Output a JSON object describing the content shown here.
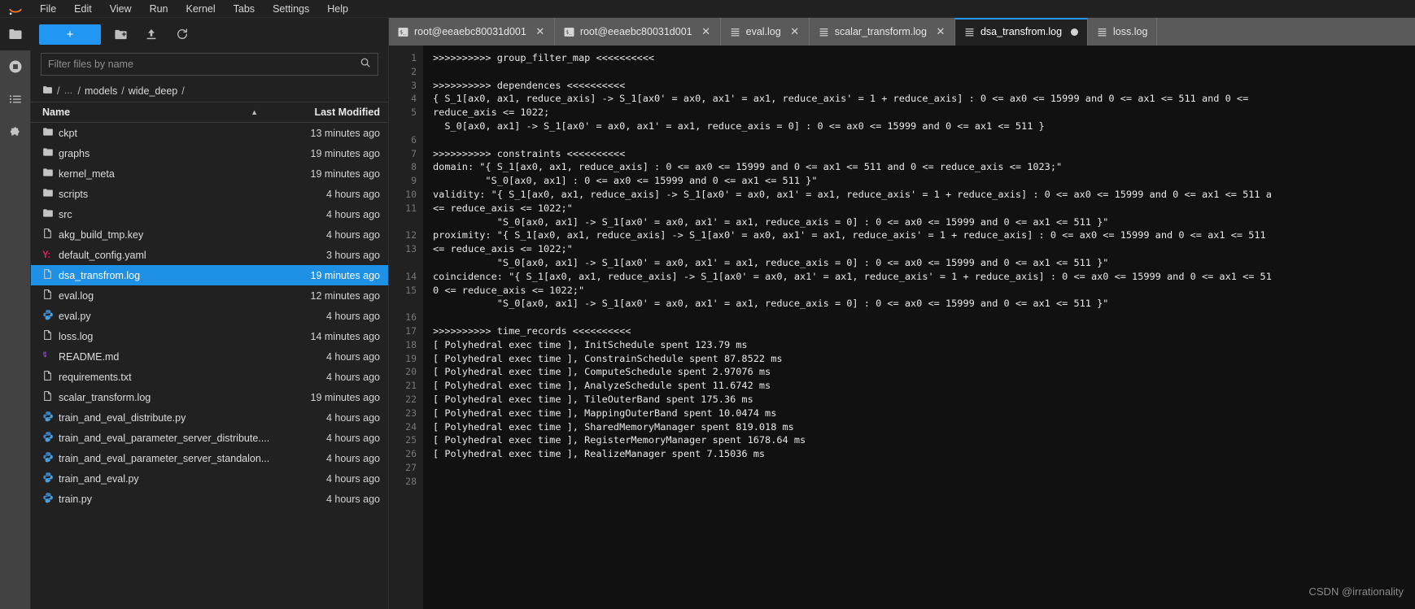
{
  "app": {
    "logo_icon": "jupyter-logo",
    "menu": [
      {
        "label": "File"
      },
      {
        "label": "Edit"
      },
      {
        "label": "View"
      },
      {
        "label": "Run"
      },
      {
        "label": "Kernel"
      },
      {
        "label": "Tabs"
      },
      {
        "label": "Settings"
      },
      {
        "label": "Help"
      }
    ]
  },
  "activity_bar": {
    "items": [
      {
        "name": "file-browser-icon",
        "icon": "folder-icon",
        "active": true
      },
      {
        "name": "running-sessions-icon",
        "icon": "stop-circle-icon",
        "active": false
      },
      {
        "name": "table-of-contents-icon",
        "icon": "list-icon",
        "active": false
      },
      {
        "name": "extension-manager-icon",
        "icon": "puzzle-icon",
        "active": false
      }
    ]
  },
  "file_browser": {
    "toolbar": {
      "new_launcher_label": "+",
      "new_folder_icon": "new-folder-icon",
      "upload_icon": "upload-icon",
      "refresh_icon": "refresh-icon"
    },
    "filter": {
      "placeholder": "Filter files by name",
      "value": "",
      "icon": "search-icon"
    },
    "breadcrumb": {
      "home_icon": "folder-icon",
      "segments": [
        "/",
        "…",
        "/",
        "models",
        "/",
        "wide_deep",
        "/"
      ]
    },
    "columns": {
      "name": "Name",
      "last_modified": "Last Modified",
      "sort_caret": "▲"
    },
    "items": [
      {
        "name": "ckpt",
        "modified": "13 minutes ago",
        "kind": "folder",
        "selected": false
      },
      {
        "name": "graphs",
        "modified": "19 minutes ago",
        "kind": "folder",
        "selected": false
      },
      {
        "name": "kernel_meta",
        "modified": "19 minutes ago",
        "kind": "folder",
        "selected": false
      },
      {
        "name": "scripts",
        "modified": "4 hours ago",
        "kind": "folder",
        "selected": false
      },
      {
        "name": "src",
        "modified": "4 hours ago",
        "kind": "folder",
        "selected": false
      },
      {
        "name": "akg_build_tmp.key",
        "modified": "4 hours ago",
        "kind": "file",
        "selected": false
      },
      {
        "name": "default_config.yaml",
        "modified": "3 hours ago",
        "kind": "yaml",
        "selected": false
      },
      {
        "name": "dsa_transfrom.log",
        "modified": "19 minutes ago",
        "kind": "file",
        "selected": true
      },
      {
        "name": "eval.log",
        "modified": "12 minutes ago",
        "kind": "file",
        "selected": false
      },
      {
        "name": "eval.py",
        "modified": "4 hours ago",
        "kind": "python",
        "selected": false
      },
      {
        "name": "loss.log",
        "modified": "14 minutes ago",
        "kind": "file",
        "selected": false
      },
      {
        "name": "README.md",
        "modified": "4 hours ago",
        "kind": "markdown",
        "selected": false
      },
      {
        "name": "requirements.txt",
        "modified": "4 hours ago",
        "kind": "file",
        "selected": false
      },
      {
        "name": "scalar_transform.log",
        "modified": "19 minutes ago",
        "kind": "file",
        "selected": false
      },
      {
        "name": "train_and_eval_distribute.py",
        "modified": "4 hours ago",
        "kind": "python",
        "selected": false
      },
      {
        "name": "train_and_eval_parameter_server_distribute....",
        "modified": "4 hours ago",
        "kind": "python",
        "selected": false
      },
      {
        "name": "train_and_eval_parameter_server_standalon...",
        "modified": "4 hours ago",
        "kind": "python",
        "selected": false
      },
      {
        "name": "train_and_eval.py",
        "modified": "4 hours ago",
        "kind": "python",
        "selected": false
      },
      {
        "name": "train.py",
        "modified": "4 hours ago",
        "kind": "python",
        "selected": false
      }
    ]
  },
  "tabs": [
    {
      "label": "root@eeaebc80031d001",
      "icon": "terminal-icon",
      "active": false,
      "closable": true,
      "dirty": false
    },
    {
      "label": "root@eeaebc80031d001",
      "icon": "terminal-icon",
      "active": false,
      "closable": true,
      "dirty": false
    },
    {
      "label": "eval.log",
      "icon": "text-file-icon",
      "active": false,
      "closable": true,
      "dirty": false
    },
    {
      "label": "scalar_transform.log",
      "icon": "text-file-icon",
      "active": false,
      "closable": true,
      "dirty": false
    },
    {
      "label": "dsa_transfrom.log",
      "icon": "text-file-icon",
      "active": true,
      "closable": false,
      "dirty": true
    },
    {
      "label": "loss.log",
      "icon": "text-file-icon",
      "active": false,
      "closable": false,
      "dirty": false
    }
  ],
  "editor": {
    "line_numbers": [
      "1",
      "2",
      "3",
      "4",
      "5",
      "",
      "6",
      "7",
      "8",
      "9",
      "10",
      "11",
      "",
      "12",
      "13",
      "",
      "14",
      "15",
      "",
      "16",
      "17",
      "18",
      "19",
      "20",
      "21",
      "22",
      "23",
      "24",
      "25",
      "26",
      "27",
      "28"
    ],
    "content": ">>>>>>>>>> group_filter_map <<<<<<<<<<\n\n>>>>>>>>>> dependences <<<<<<<<<<\n{ S_1[ax0, ax1, reduce_axis] -> S_1[ax0' = ax0, ax1' = ax1, reduce_axis' = 1 + reduce_axis] : 0 <= ax0 <= 15999 and 0 <= ax1 <= 511 and 0 <=\nreduce_axis <= 1022;\n  S_0[ax0, ax1] -> S_1[ax0' = ax0, ax1' = ax1, reduce_axis = 0] : 0 <= ax0 <= 15999 and 0 <= ax1 <= 511 }\n\n>>>>>>>>>> constraints <<<<<<<<<<\ndomain: \"{ S_1[ax0, ax1, reduce_axis] : 0 <= ax0 <= 15999 and 0 <= ax1 <= 511 and 0 <= reduce_axis <= 1023;\"\n         \"S_0[ax0, ax1] : 0 <= ax0 <= 15999 and 0 <= ax1 <= 511 }\"\nvalidity: \"{ S_1[ax0, ax1, reduce_axis] -> S_1[ax0' = ax0, ax1' = ax1, reduce_axis' = 1 + reduce_axis] : 0 <= ax0 <= 15999 and 0 <= ax1 <= 511 a\n<= reduce_axis <= 1022;\"\n           \"S_0[ax0, ax1] -> S_1[ax0' = ax0, ax1' = ax1, reduce_axis = 0] : 0 <= ax0 <= 15999 and 0 <= ax1 <= 511 }\"\nproximity: \"{ S_1[ax0, ax1, reduce_axis] -> S_1[ax0' = ax0, ax1' = ax1, reduce_axis' = 1 + reduce_axis] : 0 <= ax0 <= 15999 and 0 <= ax1 <= 511\n<= reduce_axis <= 1022;\"\n           \"S_0[ax0, ax1] -> S_1[ax0' = ax0, ax1' = ax1, reduce_axis = 0] : 0 <= ax0 <= 15999 and 0 <= ax1 <= 511 }\"\ncoincidence: \"{ S_1[ax0, ax1, reduce_axis] -> S_1[ax0' = ax0, ax1' = ax1, reduce_axis' = 1 + reduce_axis] : 0 <= ax0 <= 15999 and 0 <= ax1 <= 51\n0 <= reduce_axis <= 1022;\"\n           \"S_0[ax0, ax1] -> S_1[ax0' = ax0, ax1' = ax1, reduce_axis = 0] : 0 <= ax0 <= 15999 and 0 <= ax1 <= 511 }\"\n\n>>>>>>>>>> time_records <<<<<<<<<<\n[ Polyhedral exec time ], InitSchedule spent 123.79 ms\n[ Polyhedral exec time ], ConstrainSchedule spent 87.8522 ms\n[ Polyhedral exec time ], ComputeSchedule spent 2.97076 ms\n[ Polyhedral exec time ], AnalyzeSchedule spent 11.6742 ms\n[ Polyhedral exec time ], TileOuterBand spent 175.36 ms\n[ Polyhedral exec time ], MappingOuterBand spent 10.0474 ms\n[ Polyhedral exec time ], SharedMemoryManager spent 819.018 ms\n[ Polyhedral exec time ], RegisterMemoryManager spent 1678.64 ms\n[ Polyhedral exec time ], RealizeManager spent 7.15036 ms\n"
  },
  "watermark": "CSDN @irrationality",
  "colors": {
    "accent": "#2196f3",
    "selection": "#1e90e6",
    "panel": "#212121",
    "tabbar": "#5a5a5a",
    "editor_bg": "#111111",
    "yaml": "#e0245e",
    "markdown": "#a347e0",
    "python": "#3572A5"
  }
}
